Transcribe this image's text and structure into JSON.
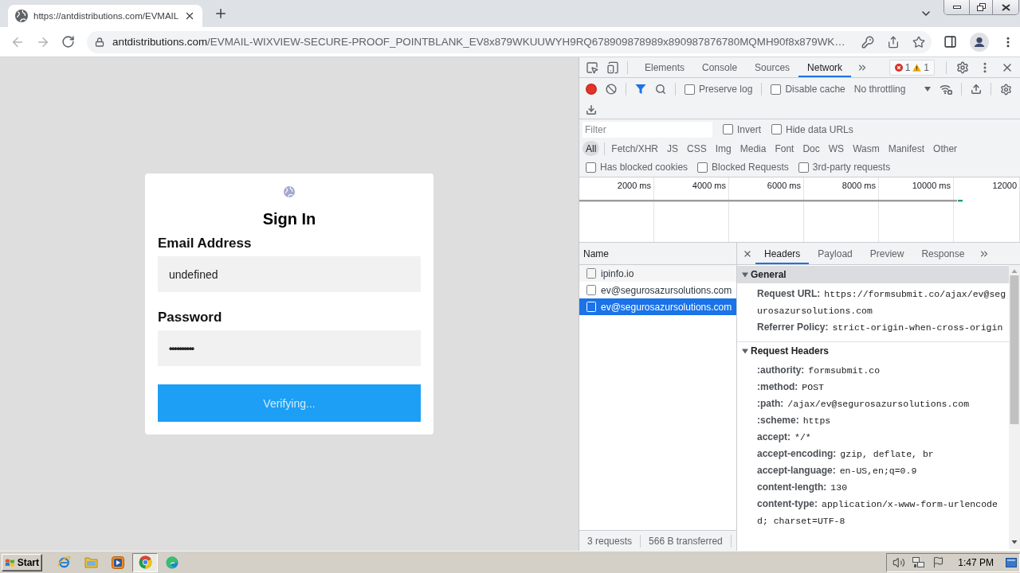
{
  "browser": {
    "tabs": [
      {
        "title": "https://antdistributions.com/EVMAIL",
        "selected": true
      }
    ],
    "address": {
      "host": "antdistributions.com",
      "path": "/EVMAIL-WIXVIEW-SECURE-PROOF_POINTBLANK_EV8x879WKUUWYH9RQ678909878989x890987876780MQMH90f8x879WK…"
    }
  },
  "login": {
    "title": "Sign In",
    "fields": [
      {
        "label": "Email Address",
        "value": "undefined"
      },
      {
        "label": "Password",
        "value": "••••••••••"
      }
    ],
    "button": "Verifying..."
  },
  "devtools": {
    "tabs": [
      {
        "label": "Elements",
        "selected": false
      },
      {
        "label": "Console",
        "selected": false
      },
      {
        "label": "Sources",
        "selected": false
      },
      {
        "label": "Network",
        "selected": true
      }
    ],
    "issues": {
      "errors": "1",
      "warnings": "1"
    },
    "toolbar": {
      "recording": true,
      "options": [
        {
          "label": "Preserve log",
          "checked": false
        },
        {
          "label": "Disable cache",
          "checked": false
        }
      ],
      "throttling": "No throttling"
    },
    "filter": {
      "placeholder": "Filter",
      "options": [
        {
          "label": "Invert",
          "checked": false
        },
        {
          "label": "Hide data URLs",
          "checked": false
        }
      ]
    },
    "types": [
      {
        "label": "All",
        "selected": true
      },
      {
        "label": "Fetch/XHR",
        "selected": false
      },
      {
        "label": "JS",
        "selected": false
      },
      {
        "label": "CSS",
        "selected": false
      },
      {
        "label": "Img",
        "selected": false
      },
      {
        "label": "Media",
        "selected": false
      },
      {
        "label": "Font",
        "selected": false
      },
      {
        "label": "Doc",
        "selected": false
      },
      {
        "label": "WS",
        "selected": false
      },
      {
        "label": "Wasm",
        "selected": false
      },
      {
        "label": "Manifest",
        "selected": false
      },
      {
        "label": "Other",
        "selected": false
      }
    ],
    "request_filters": [
      {
        "label": "Has blocked cookies",
        "checked": false
      },
      {
        "label": "Blocked Requests",
        "checked": false
      },
      {
        "label": "3rd-party requests",
        "checked": false
      }
    ],
    "overview": {
      "ticks": [
        "2000 ms",
        "4000 ms",
        "6000 ms",
        "8000 ms",
        "10000 ms",
        "12000"
      ]
    },
    "requests": {
      "column": "Name",
      "rows": [
        {
          "name": "ipinfo.io",
          "selected": false
        },
        {
          "name": "ev@segurosazursolutions.com",
          "selected": false
        },
        {
          "name": "ev@segurosazursolutions.com",
          "selected": true
        }
      ]
    },
    "summary": [
      "3 requests",
      "566 B transferred"
    ],
    "detail": {
      "tabs": [
        {
          "label": "Headers",
          "selected": true
        },
        {
          "label": "Payload",
          "selected": false
        },
        {
          "label": "Preview",
          "selected": false
        },
        {
          "label": "Response",
          "selected": false
        }
      ],
      "sections": [
        {
          "title": "General",
          "expanded": true,
          "selected": true,
          "rows": [
            {
              "name": "Request URL:",
              "value": "https://formsubmit.co/ajax/ev@segurosazursolutions.com"
            },
            {
              "name": "Referrer Policy:",
              "value": "strict-origin-when-cross-origin"
            }
          ]
        },
        {
          "title": "Request Headers",
          "expanded": true,
          "selected": false,
          "rows": [
            {
              "name": ":authority:",
              "value": "formsubmit.co"
            },
            {
              "name": ":method:",
              "value": "POST"
            },
            {
              "name": ":path:",
              "value": "/ajax/ev@segurosazursolutions.com"
            },
            {
              "name": ":scheme:",
              "value": "https"
            },
            {
              "name": "accept:",
              "value": "*/*"
            },
            {
              "name": "accept-encoding:",
              "value": "gzip, deflate, br"
            },
            {
              "name": "accept-language:",
              "value": "en-US,en;q=0.9"
            },
            {
              "name": "content-length:",
              "value": "130"
            },
            {
              "name": "content-type:",
              "value": "application/x-www-form-urlencoded; charset=UTF-8"
            }
          ]
        }
      ]
    }
  },
  "taskbar": {
    "start": "Start",
    "apps": [
      {
        "kind": "ie",
        "selected": false
      },
      {
        "kind": "folder",
        "selected": false
      },
      {
        "kind": "media",
        "selected": false
      },
      {
        "kind": "chrome",
        "selected": true
      },
      {
        "kind": "edge",
        "selected": false
      }
    ],
    "clock": "1:47 PM"
  }
}
